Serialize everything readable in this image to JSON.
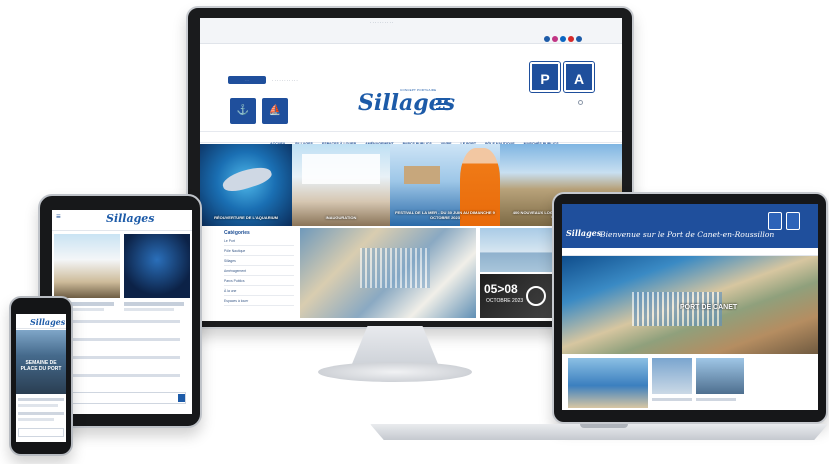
{
  "brand": {
    "name": "Sillages",
    "tagline": "CONCEPT PORTUAIRE",
    "colors": {
      "primary": "#1d5ba8",
      "navy": "#1f4f9c",
      "nav_text": "#1d4e94"
    }
  },
  "monitor": {
    "nav_items": [
      "ACCUEIL",
      "SILLAGES",
      "ESPACES À LOUER",
      "AMÉNAGEMENT",
      "PARCS PUBLICS",
      "VIVRE",
      "LE PORT",
      "PÔLE NAUTIQUE",
      "MARCHÉS PUBLICS"
    ],
    "hero_captions": [
      "RÉOUVERTURE DE L'AQUARIUM",
      "INAUGURATION",
      "FESTIVAL DE LA MER - DU 30 JUIN AU DIMANCHE 9 OCTOBRE 2023",
      "400 NOUVEAUX LOGEMENTS DANS UN ÉCRIN DE VERDURE"
    ],
    "sidebar_title": "Catégories",
    "sidebar_items": [
      "Le Port",
      "Pôle Nautique",
      "Sillages",
      "Aménagement",
      "Parcs Publics",
      "À la une",
      "Espaces à louer"
    ],
    "video_overlay": "05>08",
    "video_sub": "OCTOBRE 2023",
    "side_icon_p": "P",
    "side_icon_a": "A"
  },
  "tablet": {
    "nav_label": "≡"
  },
  "phone": {
    "hero_text": "SEMAINE DE PLACE DU PORT"
  },
  "laptop": {
    "welcome": "Bienvenue sur le Port de Canet-en-Roussillon",
    "hero_label": "PORT DE CANET"
  }
}
